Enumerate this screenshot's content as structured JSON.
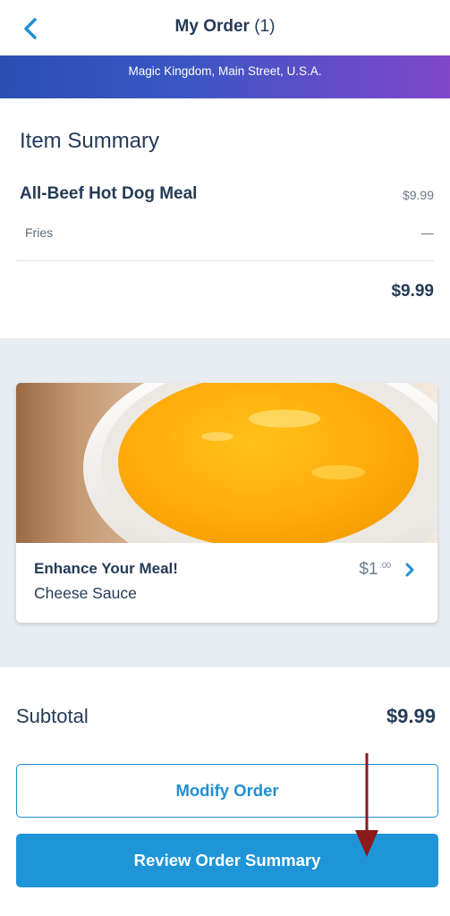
{
  "header": {
    "title": "My Order",
    "count": "(1)",
    "back_icon": "chevron-left-icon"
  },
  "banner": {
    "subtitle": "Magic Kingdom, Main Street, U.S.A."
  },
  "summary": {
    "title": "Item Summary",
    "item": {
      "name": "All-Beef Hot Dog Meal",
      "price": "$9.99",
      "modifier": {
        "name": "Fries",
        "price": "—"
      }
    },
    "total": "$9.99"
  },
  "upsell": {
    "title": "Enhance Your Meal!",
    "item": "Cheese Sauce",
    "price_main": "$1",
    "price_cents": ".00",
    "chevron_icon": "chevron-right-icon"
  },
  "subtotal": {
    "label": "Subtotal",
    "value": "$9.99"
  },
  "buttons": {
    "modify": "Modify Order",
    "review": "Review Order Summary"
  },
  "colors": {
    "accent": "#1f95d8",
    "text": "#253b56",
    "annotation": "#8b1a1a"
  }
}
